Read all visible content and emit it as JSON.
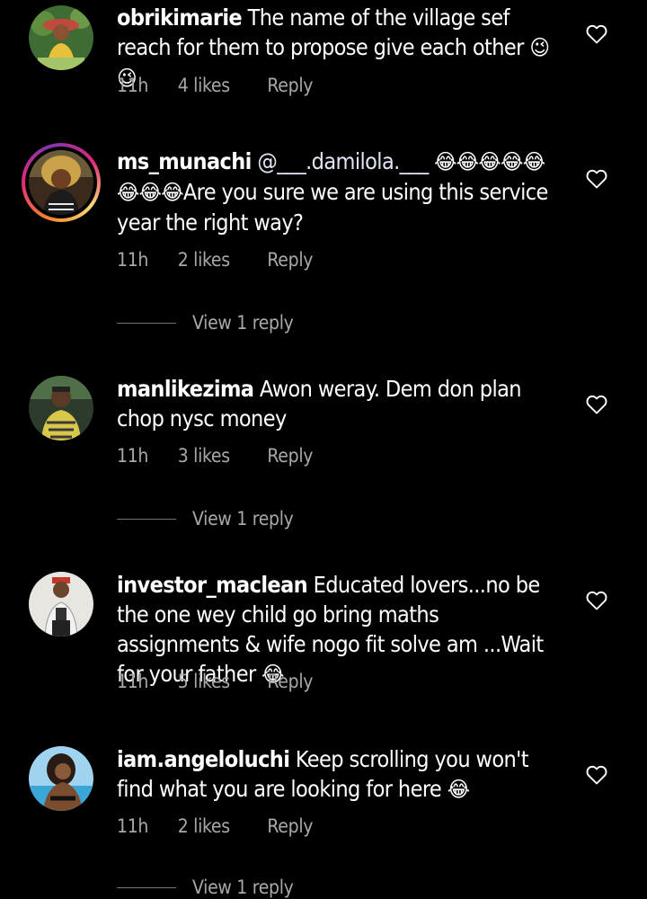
{
  "comments": [
    {
      "username": "obrikimarie",
      "text": "The name of the village sef reach for them to propose give each other",
      "emojis_after": "😉 😉",
      "time": "11h",
      "likes": "4 likes",
      "reply_label": "Reply"
    },
    {
      "username": "ms_munachi",
      "mention": "@___.damilola.___",
      "emojis_before": "😂😂😂😂😂😂😂😂",
      "text": "Are you sure we are using this service year the right way?",
      "time": "11h",
      "likes": "2 likes",
      "reply_label": "Reply",
      "view_replies": "View 1 reply"
    },
    {
      "username": "manlikezima",
      "text": "Awon weray. Dem don plan chop nysc money",
      "time": "11h",
      "likes": "3 likes",
      "reply_label": "Reply",
      "view_replies": "View 1 reply"
    },
    {
      "username": "investor_maclean",
      "text": "Educated lovers...no be the one wey child go bring maths assignments & wife nogo fit solve am ...Wait for your father",
      "emojis_after": "😂",
      "time": "11h",
      "likes": "5 likes",
      "reply_label": "Reply"
    },
    {
      "username": "iam.angeloluchi",
      "text": "Keep scrolling you won't find what you are looking for here",
      "emojis_after": "😂",
      "time": "11h",
      "likes": "2 likes",
      "reply_label": "Reply",
      "view_replies": "View 1 reply"
    }
  ],
  "icons": {
    "like": "heart-outline-icon",
    "avatar": "user-avatar"
  },
  "colors": {
    "background": "#000000",
    "text": "#ffffff",
    "secondary": "#a8a8a8",
    "story_ring": "#dd2a7b"
  }
}
